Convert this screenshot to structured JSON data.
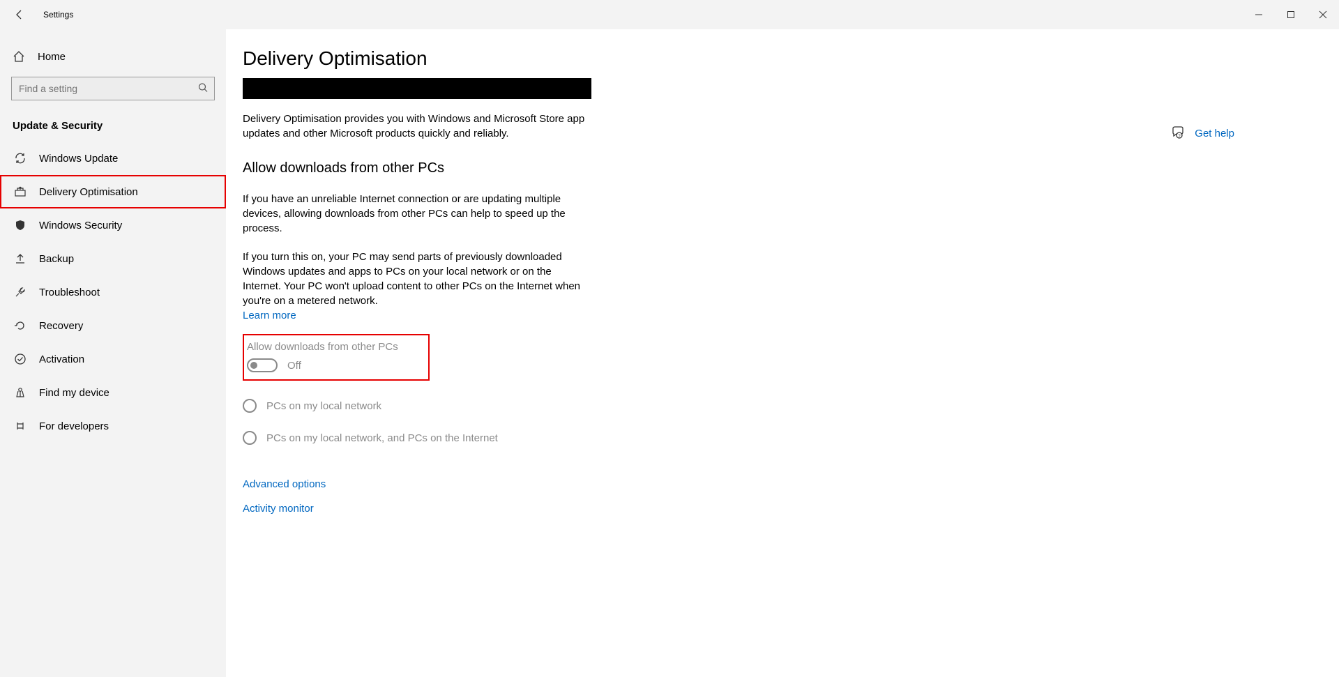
{
  "window": {
    "title": "Settings"
  },
  "sidebar": {
    "home": "Home",
    "search_placeholder": "Find a setting",
    "section": "Update & Security",
    "items": [
      {
        "label": "Windows Update"
      },
      {
        "label": "Delivery Optimisation",
        "highlighted": true
      },
      {
        "label": "Windows Security"
      },
      {
        "label": "Backup"
      },
      {
        "label": "Troubleshoot"
      },
      {
        "label": "Recovery"
      },
      {
        "label": "Activation"
      },
      {
        "label": "Find my device"
      },
      {
        "label": "For developers"
      }
    ]
  },
  "main": {
    "title": "Delivery Optimisation",
    "intro": "Delivery Optimisation provides you with Windows and Microsoft Store app updates and other Microsoft products quickly and reliably.",
    "section_heading": "Allow downloads from other PCs",
    "para1": "If you have an unreliable Internet connection or are updating multiple devices, allowing downloads from other PCs can help to speed up the process.",
    "para2": "If you turn this on, your PC may send parts of previously downloaded Windows updates and apps to PCs on your local network or on the Internet. Your PC won't upload content to other PCs on the Internet when you're on a metered network.",
    "learn_more": "Learn more",
    "toggle_label": "Allow downloads from other PCs",
    "toggle_state": "Off",
    "radio1": "PCs on my local network",
    "radio2": "PCs on my local network, and PCs on the Internet",
    "adv_options": "Advanced options",
    "activity_monitor": "Activity monitor"
  },
  "help": {
    "label": "Get help"
  }
}
